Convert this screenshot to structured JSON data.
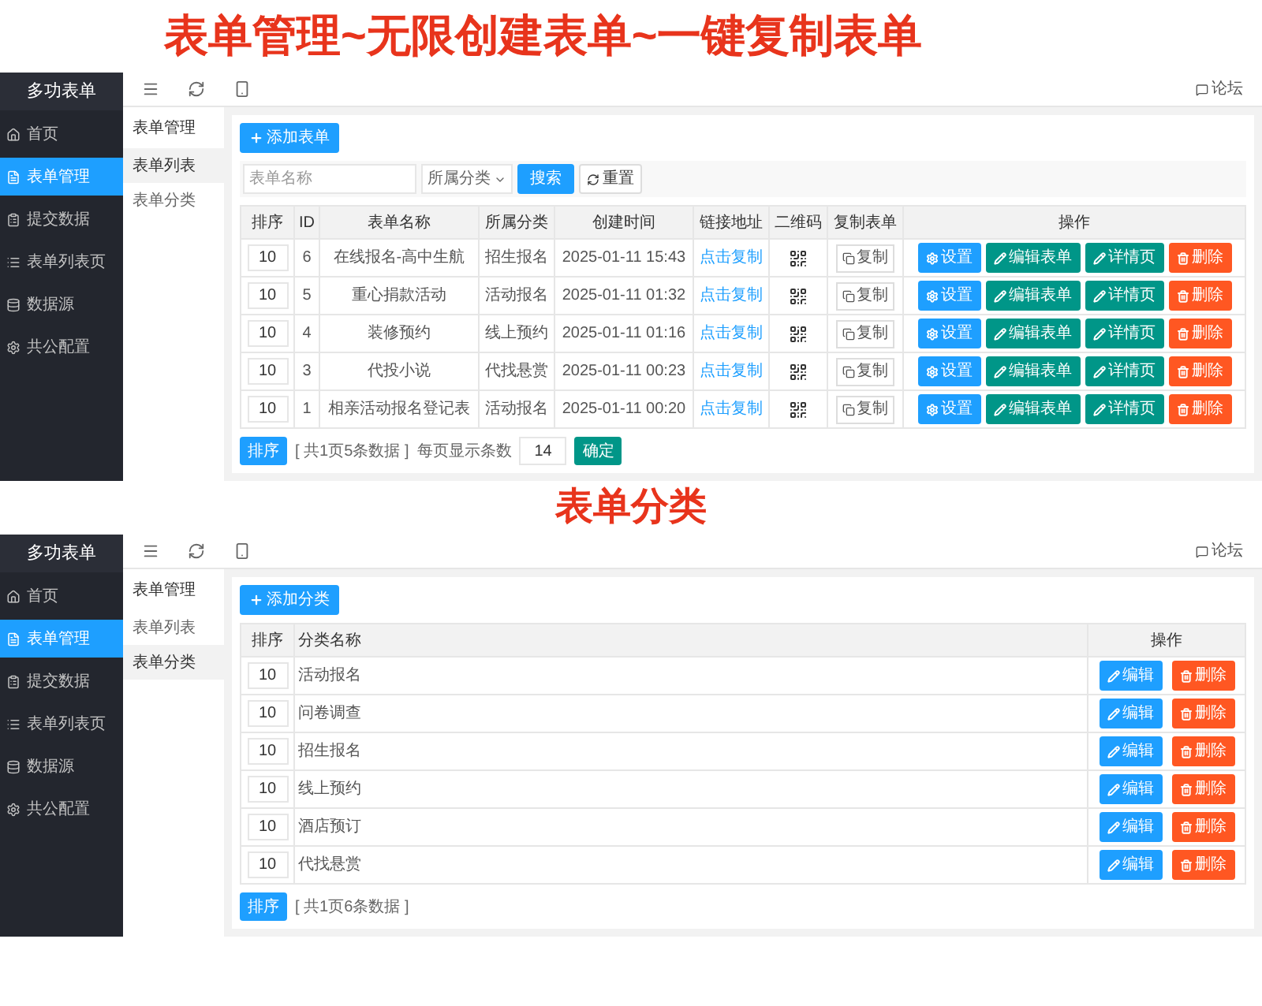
{
  "banner": {
    "title": "表单管理~无限创建表单~一键复制表单"
  },
  "screens": [
    {
      "kind": "form_list",
      "app_title": "多功表单",
      "topbar_link": "论坛",
      "sidebar": [
        {
          "label": "首页",
          "selected": false
        },
        {
          "label": "表单管理",
          "selected": true
        },
        {
          "label": "提交数据",
          "selected": false
        },
        {
          "label": "表单列表页",
          "selected": false
        },
        {
          "label": "数据源",
          "selected": false
        },
        {
          "label": "共公配置",
          "selected": false
        }
      ],
      "subnav": {
        "title": "表单管理",
        "items": [
          {
            "label": "表单列表",
            "selected": true
          },
          {
            "label": "表单分类",
            "selected": false
          }
        ]
      },
      "add_button": "添加表单",
      "search": {
        "placeholder": "表单名称",
        "filter": "所属分类",
        "search_button": "搜索",
        "reset_button": "重置"
      },
      "columns": [
        "排序",
        "ID",
        "表单名称",
        "所属分类",
        "创建时间",
        "链接地址",
        "二维码",
        "复制表单",
        "操作"
      ],
      "rows": [
        {
          "sort": "10",
          "id": "6",
          "name": "在线报名-高中生航",
          "category": "招生报名",
          "created": "2025-01-11 15:43",
          "link": "点击复制",
          "copy": "复制",
          "actions": [
            {
              "label": "设置",
              "kind": "settings"
            },
            {
              "label": "编辑表单",
              "kind": "edit"
            },
            {
              "label": "详情页",
              "kind": "detail"
            },
            {
              "label": "删除",
              "kind": "delete"
            }
          ]
        },
        {
          "sort": "10",
          "id": "5",
          "name": "重心捐款活动",
          "category": "活动报名",
          "created": "2025-01-11 01:32",
          "link": "点击复制",
          "copy": "复制",
          "actions": [
            {
              "label": "设置",
              "kind": "settings"
            },
            {
              "label": "编辑表单",
              "kind": "edit"
            },
            {
              "label": "详情页",
              "kind": "detail"
            },
            {
              "label": "删除",
              "kind": "delete"
            }
          ]
        },
        {
          "sort": "10",
          "id": "4",
          "name": "装修预约",
          "category": "线上预约",
          "created": "2025-01-11 01:16",
          "link": "点击复制",
          "copy": "复制",
          "actions": [
            {
              "label": "设置",
              "kind": "settings"
            },
            {
              "label": "编辑表单",
              "kind": "edit"
            },
            {
              "label": "详情页",
              "kind": "detail"
            },
            {
              "label": "删除",
              "kind": "delete"
            }
          ]
        },
        {
          "sort": "10",
          "id": "3",
          "name": "代投小说",
          "category": "代找悬赏",
          "created": "2025-01-11 00:23",
          "link": "点击复制",
          "copy": "复制",
          "actions": [
            {
              "label": "设置",
              "kind": "settings"
            },
            {
              "label": "编辑表单",
              "kind": "edit"
            },
            {
              "label": "详情页",
              "kind": "detail"
            },
            {
              "label": "删除",
              "kind": "delete"
            }
          ]
        },
        {
          "sort": "10",
          "id": "1",
          "name": "相亲活动报名登记表",
          "category": "活动报名",
          "created": "2025-01-11 00:20",
          "link": "点击复制",
          "copy": "复制",
          "actions": [
            {
              "label": "设置",
              "kind": "settings"
            },
            {
              "label": "编辑表单",
              "kind": "edit"
            },
            {
              "label": "详情页",
              "kind": "detail"
            },
            {
              "label": "删除",
              "kind": "delete"
            }
          ]
        }
      ],
      "footer": {
        "sort_button": "排序",
        "summary": "[ 共1页5条数据 ]",
        "per_page_label": "每页显示条数",
        "per_page": "14",
        "confirm_button": "确定"
      }
    },
    {
      "kind": "category_list",
      "heading": "表单分类",
      "app_title": "多功表单",
      "topbar_link": "论坛",
      "sidebar": [
        {
          "label": "首页",
          "selected": false
        },
        {
          "label": "表单管理",
          "selected": true
        },
        {
          "label": "提交数据",
          "selected": false
        },
        {
          "label": "表单列表页",
          "selected": false
        },
        {
          "label": "数据源",
          "selected": false
        },
        {
          "label": "共公配置",
          "selected": false
        }
      ],
      "subnav": {
        "title": "表单管理",
        "items": [
          {
            "label": "表单列表",
            "selected": false
          },
          {
            "label": "表单分类",
            "selected": true
          }
        ]
      },
      "add_button": "添加分类",
      "columns": [
        "排序",
        "分类名称",
        "操作"
      ],
      "rows": [
        {
          "sort": "10",
          "name": "活动报名",
          "actions": [
            {
              "label": "编辑",
              "kind": "modify"
            },
            {
              "label": "删除",
              "kind": "delete"
            }
          ]
        },
        {
          "sort": "10",
          "name": "问卷调查",
          "actions": [
            {
              "label": "编辑",
              "kind": "modify"
            },
            {
              "label": "删除",
              "kind": "delete"
            }
          ]
        },
        {
          "sort": "10",
          "name": "招生报名",
          "actions": [
            {
              "label": "编辑",
              "kind": "modify"
            },
            {
              "label": "删除",
              "kind": "delete"
            }
          ]
        },
        {
          "sort": "10",
          "name": "线上预约",
          "actions": [
            {
              "label": "编辑",
              "kind": "modify"
            },
            {
              "label": "删除",
              "kind": "delete"
            }
          ]
        },
        {
          "sort": "10",
          "name": "酒店预订",
          "actions": [
            {
              "label": "编辑",
              "kind": "modify"
            },
            {
              "label": "删除",
              "kind": "delete"
            }
          ]
        },
        {
          "sort": "10",
          "name": "代找悬赏",
          "actions": [
            {
              "label": "编辑",
              "kind": "modify"
            },
            {
              "label": "删除",
              "kind": "delete"
            }
          ]
        }
      ],
      "footer": {
        "sort_button": "排序",
        "summary": "[ 共1页6条数据 ]"
      }
    }
  ]
}
